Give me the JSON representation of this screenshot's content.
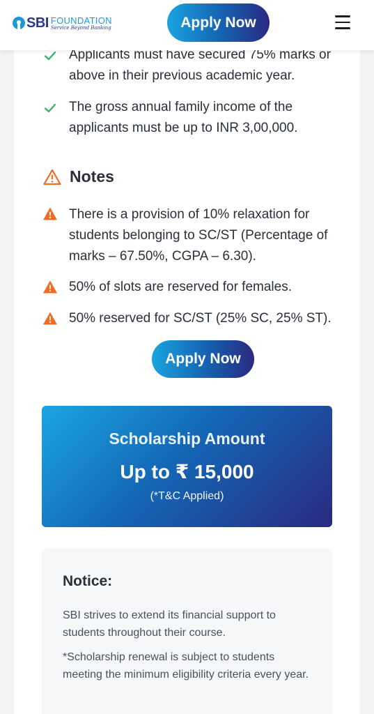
{
  "header": {
    "logo_brand": "SBI",
    "logo_foundation": "FOUNDATION",
    "logo_tagline": "Service Beyond Banking",
    "apply_label": "Apply Now",
    "menu_icon": "hamburger-icon"
  },
  "eligibility": {
    "items": [
      "Applicants must have secured 75% marks or above in their previous academic year.",
      "The gross annual family income of the applicants must be up to INR 3,00,000."
    ],
    "icon": "check-icon",
    "icon_color": "#3bb36a"
  },
  "notes": {
    "title": "Notes",
    "icon": "warning-outline-icon",
    "item_icon": "warning-filled-icon",
    "accent_color": "#f26b22",
    "items": [
      "There is a provision of 10% relaxation for students belonging to SC/ST (Percentage of marks – 67.50%, CGPA – 6.30).",
      "50% of slots are reserved for females.",
      "50% reserved for SC/ST (25% SC, 25% ST)."
    ]
  },
  "apply_button": {
    "label": "Apply Now"
  },
  "scholarship": {
    "title": "Scholarship Amount",
    "amount": "Up to ₹ 15,000",
    "note": "(*T&C Applied)"
  },
  "notice": {
    "title": "Notice:",
    "paragraphs": [
      "SBI strives to extend its financial support to students throughout their course.",
      "*Scholarship renewal is subject to students meeting the minimum eligibility criteria every year."
    ]
  },
  "colors": {
    "gradient_start": "#1aa4e0",
    "gradient_end": "#2a2a80"
  }
}
